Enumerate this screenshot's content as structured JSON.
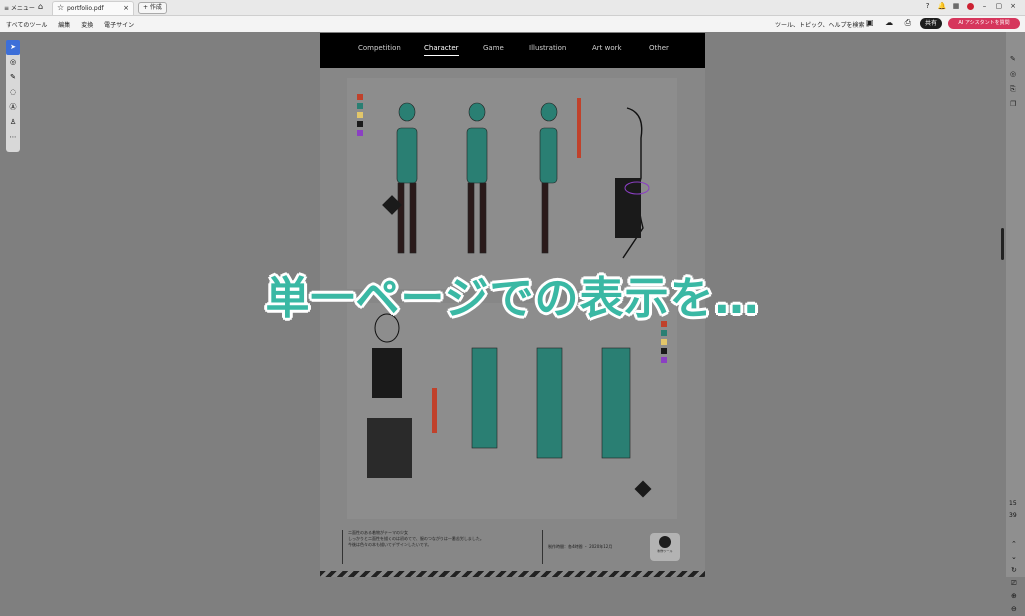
{
  "titlebar": {
    "menu_label": "≡ メニュー",
    "tab_name": "portfolio.pdf",
    "tab_close": "×",
    "new_tab": "+ 作成"
  },
  "menubar": {
    "items": [
      "すべてのツール",
      "編集",
      "変換",
      "電子サイン"
    ],
    "search_placeholder": "ツール、トピック、ヘルプを検索",
    "share_label": "共有",
    "ai_label": "AI アシスタントを質問"
  },
  "document": {
    "nav": [
      "Competition",
      "Character",
      "Game",
      "Illustration",
      "Art work",
      "Other"
    ],
    "active_nav": "Character",
    "caption_lines": [
      "二面性のある着物がテーマの少女",
      "しっかりと二面性を描くのは初めてで、服のつながりは一番苦労しました。",
      "今後は色々の本も描いてデザインしたいです。"
    ],
    "credit": "制作時間：各4時間 ・ 2020年12月",
    "logo_label": "制作ツール"
  },
  "page_numbers": [
    "15",
    "39"
  ],
  "overlay_text": "単一ページでの表示を…",
  "colors": {
    "swatch_1": "#c0412b",
    "swatch_2": "#2a7f73",
    "swatch_3": "#e2c66a",
    "swatch_4": "#1a1a1a",
    "swatch_5": "#8b3fc3",
    "overlay": "#3ab8a4",
    "ai_button": "#d6365c"
  }
}
